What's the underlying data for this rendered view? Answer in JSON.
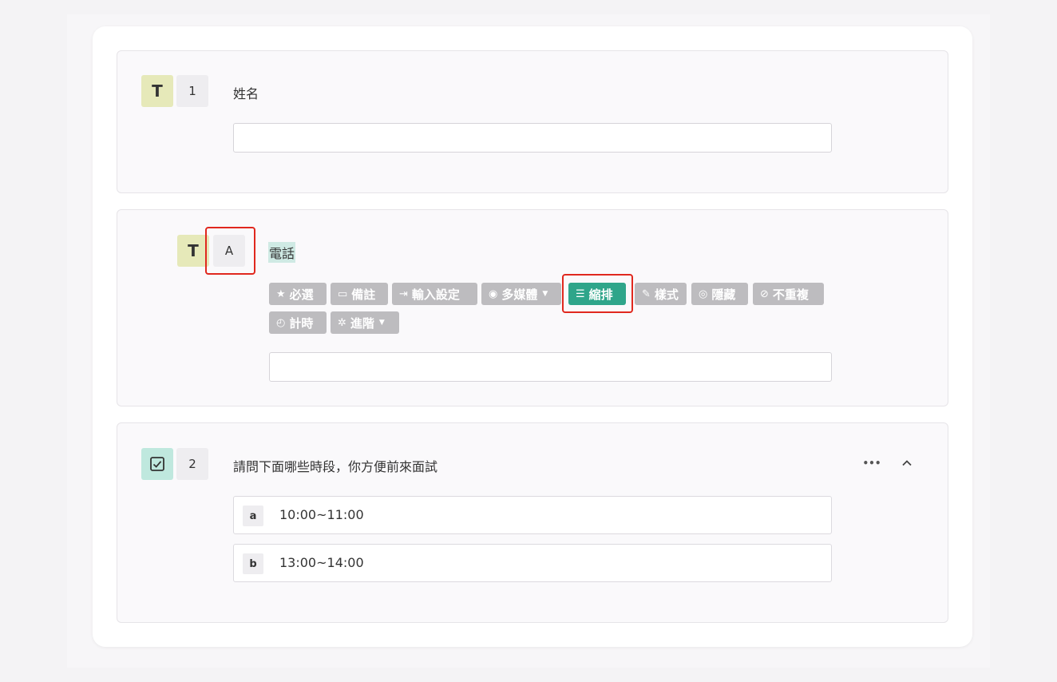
{
  "questions": [
    {
      "type_badge": "T",
      "number": "1",
      "title": "姓名"
    },
    {
      "type_badge": "T",
      "number": "A",
      "title": "電話"
    },
    {
      "type_badge_icon": "checkbox-icon",
      "number": "2",
      "title": "請問下面哪些時段，你方便前來面試"
    }
  ],
  "toolbar": {
    "row1": [
      {
        "icon": "★",
        "label": "必選"
      },
      {
        "icon": "▭",
        "label": "備註"
      },
      {
        "icon": "⇥",
        "label": "輸入設定"
      },
      {
        "icon": "◉",
        "label": "多媒體",
        "dropdown": true
      },
      {
        "icon": "☰",
        "label": "縮排",
        "active": true
      },
      {
        "icon": "✎",
        "label": "樣式"
      },
      {
        "icon": "◎",
        "label": "隱藏"
      },
      {
        "icon": "⊘",
        "label": "不重複"
      }
    ],
    "row2": [
      {
        "icon": "◴",
        "label": "計時"
      },
      {
        "icon": "✲",
        "label": "進階",
        "dropdown": true
      }
    ]
  },
  "options": [
    {
      "key": "a",
      "text": "10:00~11:00"
    },
    {
      "key": "b",
      "text": "13:00~14:00"
    }
  ],
  "menu_icons": {
    "more": "•••",
    "collapse": "⌃"
  },
  "colors": {
    "accent": "#2fa58a",
    "toolbar_bg": "#bdbcbf",
    "type_badge": "#e6e9b9",
    "check_badge": "#bfe8de",
    "highlight": "#e0281e"
  }
}
